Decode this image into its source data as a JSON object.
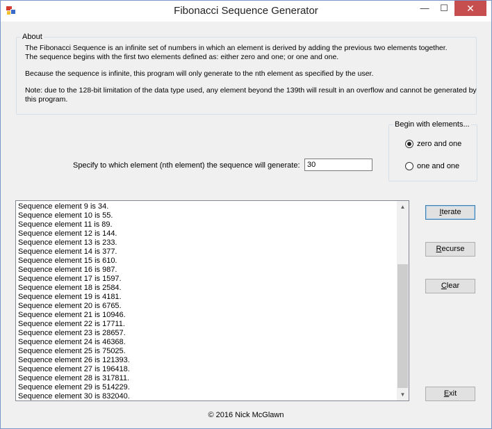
{
  "window": {
    "title": "Fibonacci Sequence Generator",
    "controls": {
      "minimize": "—",
      "maximize": "☐",
      "close": "✕"
    }
  },
  "about": {
    "legend": "About",
    "line1": "The Fibonacci Sequence is an infinite set of numbers in which an element is derived by adding the previous two elements together.",
    "line2": "The sequence begins with the first two elements defined as: either zero and one; or one and one.",
    "para2": "Because the sequence is infinite, this program will only generate to the nth element as specified by the user.",
    "para3": "Note: due to the 128-bit limitation of the data type used, any element beyond the 139th will result in an overflow and cannot be generated by this program."
  },
  "begin_with": {
    "legend": "Begin with elements...",
    "options": [
      {
        "label": "zero and one",
        "selected": true
      },
      {
        "label": "one and one",
        "selected": false
      }
    ]
  },
  "spec": {
    "label": "Specify to which element (nth element) the sequence will generate:",
    "value": "30"
  },
  "results": [
    "Sequence element 9 is 34.",
    "Sequence element 10 is 55.",
    "Sequence element 11 is 89.",
    "Sequence element 12 is 144.",
    "Sequence element 13 is 233.",
    "Sequence element 14 is 377.",
    "Sequence element 15 is 610.",
    "Sequence element 16 is 987.",
    "Sequence element 17 is 1597.",
    "Sequence element 18 is 2584.",
    "Sequence element 19 is 4181.",
    "Sequence element 20 is 6765.",
    "Sequence element 21 is 10946.",
    "Sequence element 22 is 17711.",
    "Sequence element 23 is 28657.",
    "Sequence element 24 is 46368.",
    "Sequence element 25 is 75025.",
    "Sequence element 26 is 121393.",
    "Sequence element 27 is 196418.",
    "Sequence element 28 is 317811.",
    "Sequence element 29 is 514229.",
    "Sequence element 30 is 832040."
  ],
  "buttons": {
    "iterate": {
      "first": "I",
      "rest": "terate"
    },
    "recurse": {
      "first": "R",
      "rest": "ecurse"
    },
    "clear": {
      "first": "C",
      "rest": "lear"
    },
    "exit": {
      "first": "E",
      "rest": "xit"
    }
  },
  "footer": "© 2016 Nick McGlawn"
}
